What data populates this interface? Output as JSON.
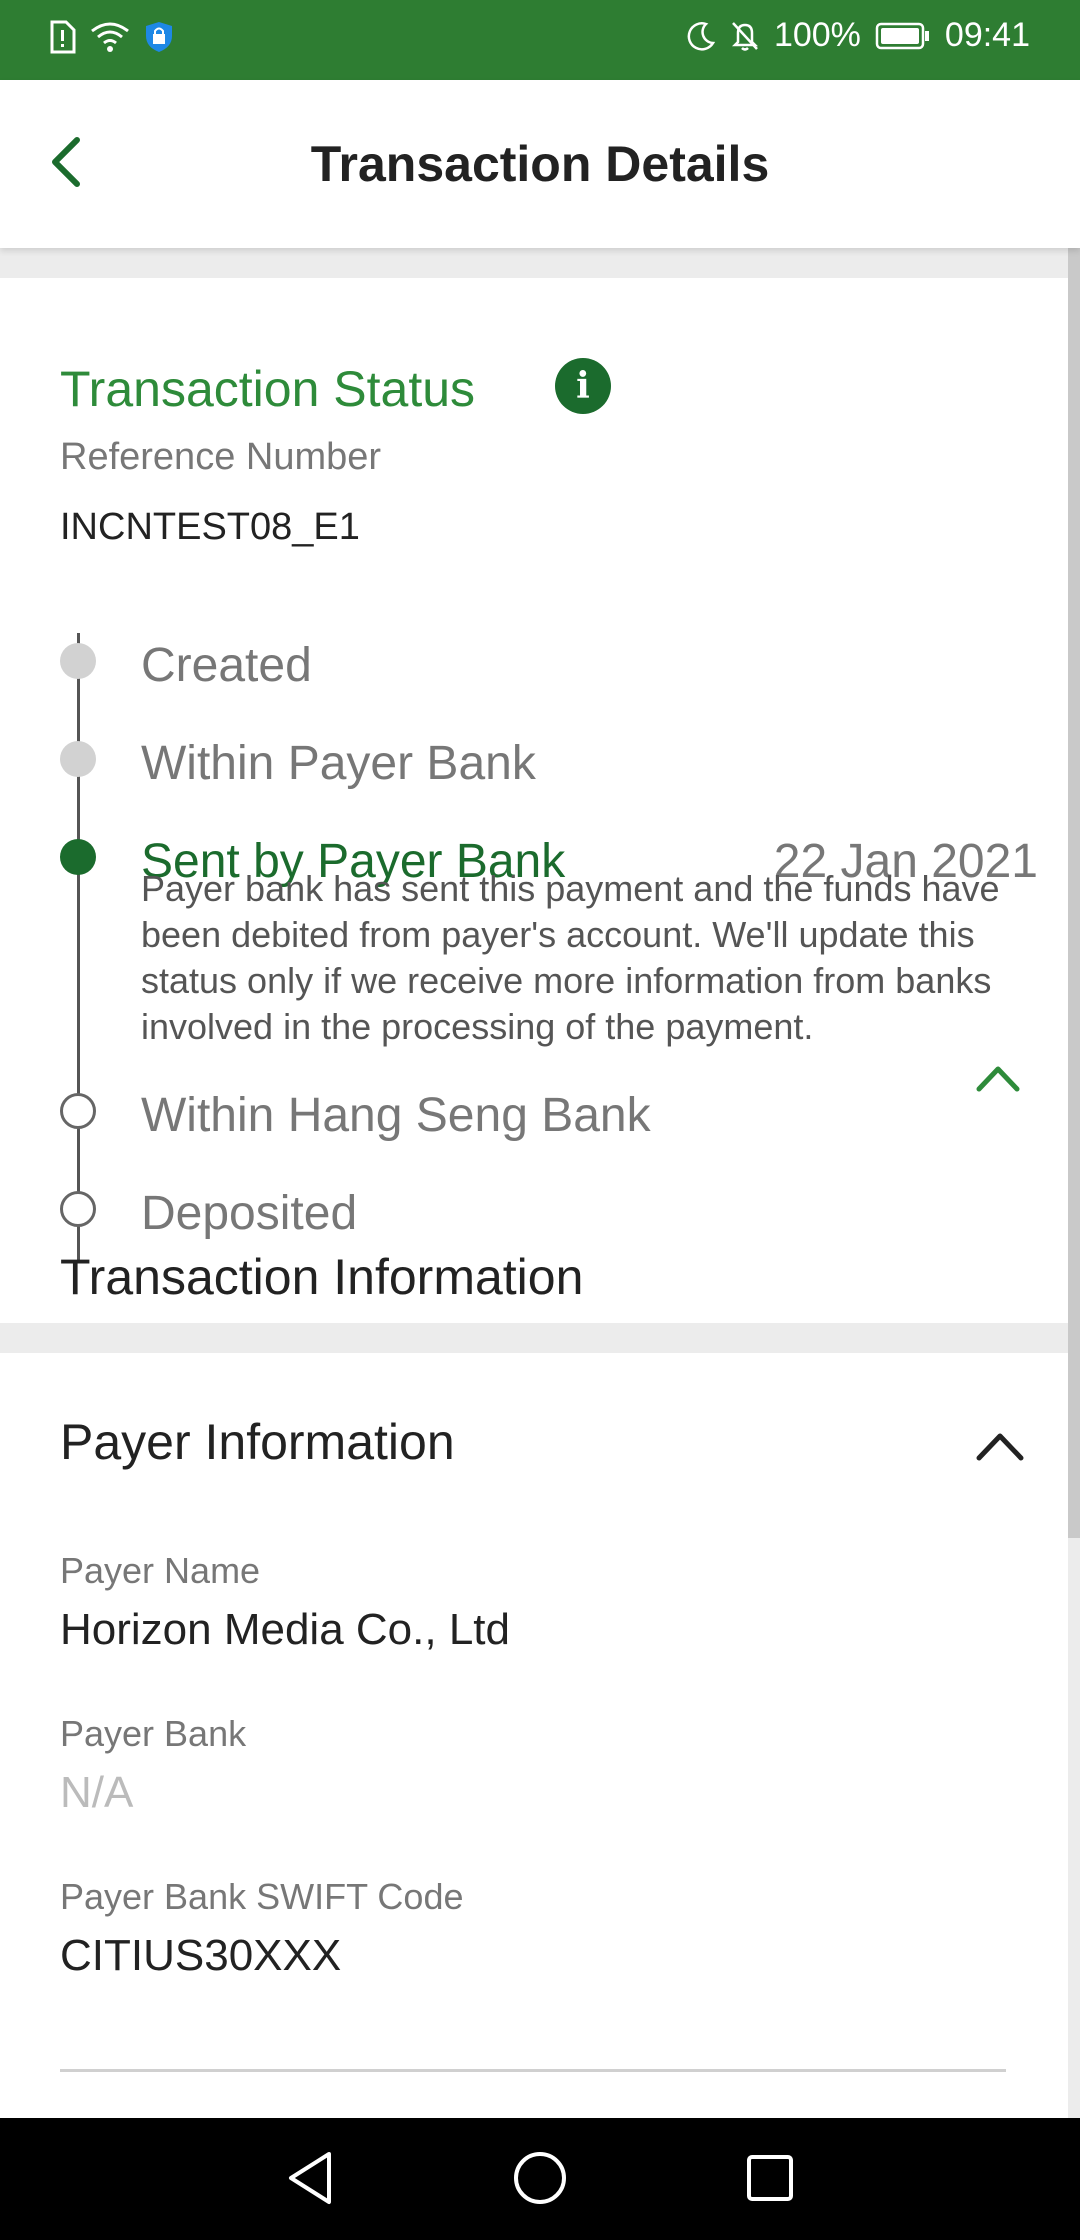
{
  "status_bar": {
    "battery": "100%",
    "time": "09:41",
    "left_icons": [
      "sim-alert-icon",
      "wifi-icon",
      "vpn-shield-icon"
    ],
    "right_icons": [
      "moon-icon",
      "bell-off-icon",
      "battery-icon"
    ]
  },
  "header": {
    "title": "Transaction Details",
    "back_icon": "chevron-left-icon"
  },
  "status": {
    "title": "Transaction Status",
    "info_icon": "info-icon",
    "reference_label": "Reference Number",
    "reference_value": "INCNTEST08_E1",
    "steps": [
      {
        "label": "Created",
        "state": "done"
      },
      {
        "label": "Within Payer Bank",
        "state": "done"
      },
      {
        "label": "Sent by Payer Bank",
        "state": "active",
        "date": "22 Jan 2021",
        "description": "Payer bank has sent this payment and the funds have been debited from payer's account. We'll update this status only if we receive more information from banks involved in the processing of the payment."
      },
      {
        "label": "Within Hang Seng Bank",
        "state": "pending"
      },
      {
        "label": "Deposited",
        "state": "pending"
      }
    ]
  },
  "payer": {
    "title": "Payer Information",
    "name_label": "Payer Name",
    "name_value": "Horizon Media Co., Ltd",
    "bank_label": "Payer Bank",
    "bank_value": "N/A",
    "swift_label": "Payer Bank SWIFT Code",
    "swift_value": "CITIUS30XXX"
  },
  "next_section": {
    "title_partial": "Transaction Information"
  },
  "colors": {
    "brand_green": "#2e7d32",
    "accent_green": "#2e8b3a",
    "dark_green": "#1b6b2d"
  }
}
